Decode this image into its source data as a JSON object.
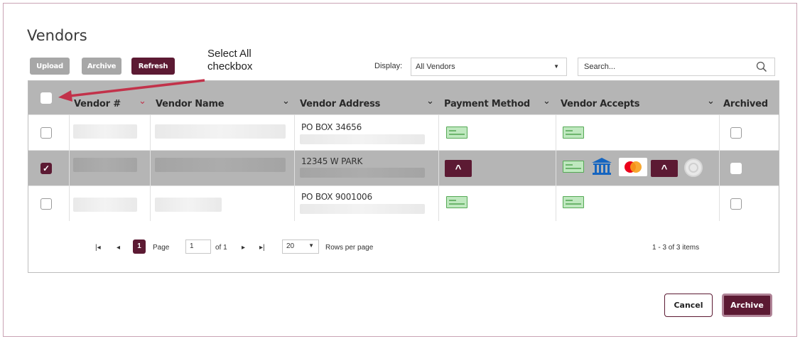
{
  "page": {
    "title": "Vendors"
  },
  "toolbar": {
    "upload_label": "Upload",
    "archive_label": "Archive",
    "refresh_label": "Refresh"
  },
  "annotation": {
    "line1": "Select All",
    "line2": "checkbox",
    "arrow_color": "#c2324a"
  },
  "display": {
    "label": "Display:",
    "value": "All Vendors"
  },
  "search": {
    "placeholder": "Search..."
  },
  "columns": [
    "Vendor #",
    "Vendor Name",
    "Vendor Address",
    "Payment Method",
    "Vendor Accepts",
    "Archived"
  ],
  "rows": [
    {
      "selected": false,
      "address": "PO BOX 34656",
      "payment": "check-icon",
      "accepts": [
        "check-icon"
      ]
    },
    {
      "selected": true,
      "address": "12345 W PARK",
      "payment": "a-payment-icon",
      "accepts": [
        "check-icon",
        "bank-icon",
        "mastercard-icon",
        "a-payment-icon",
        "globe-icon"
      ]
    },
    {
      "selected": false,
      "address": "PO BOX 9001006",
      "payment": "check-icon",
      "accepts": [
        "check-icon"
      ]
    }
  ],
  "pager": {
    "current_page": "1",
    "page_label": "Page",
    "page_input": "1",
    "of_label": "of 1",
    "rows_per_page": "20",
    "rows_label": "Rows per page",
    "items_summary": "1 - 3 of 3 items"
  },
  "footer": {
    "cancel_label": "Cancel",
    "archive_label": "Archive"
  },
  "colors": {
    "brand": "#5c1a33",
    "header_bg": "#b5b5b5",
    "disabled": "#a7a7a7"
  }
}
